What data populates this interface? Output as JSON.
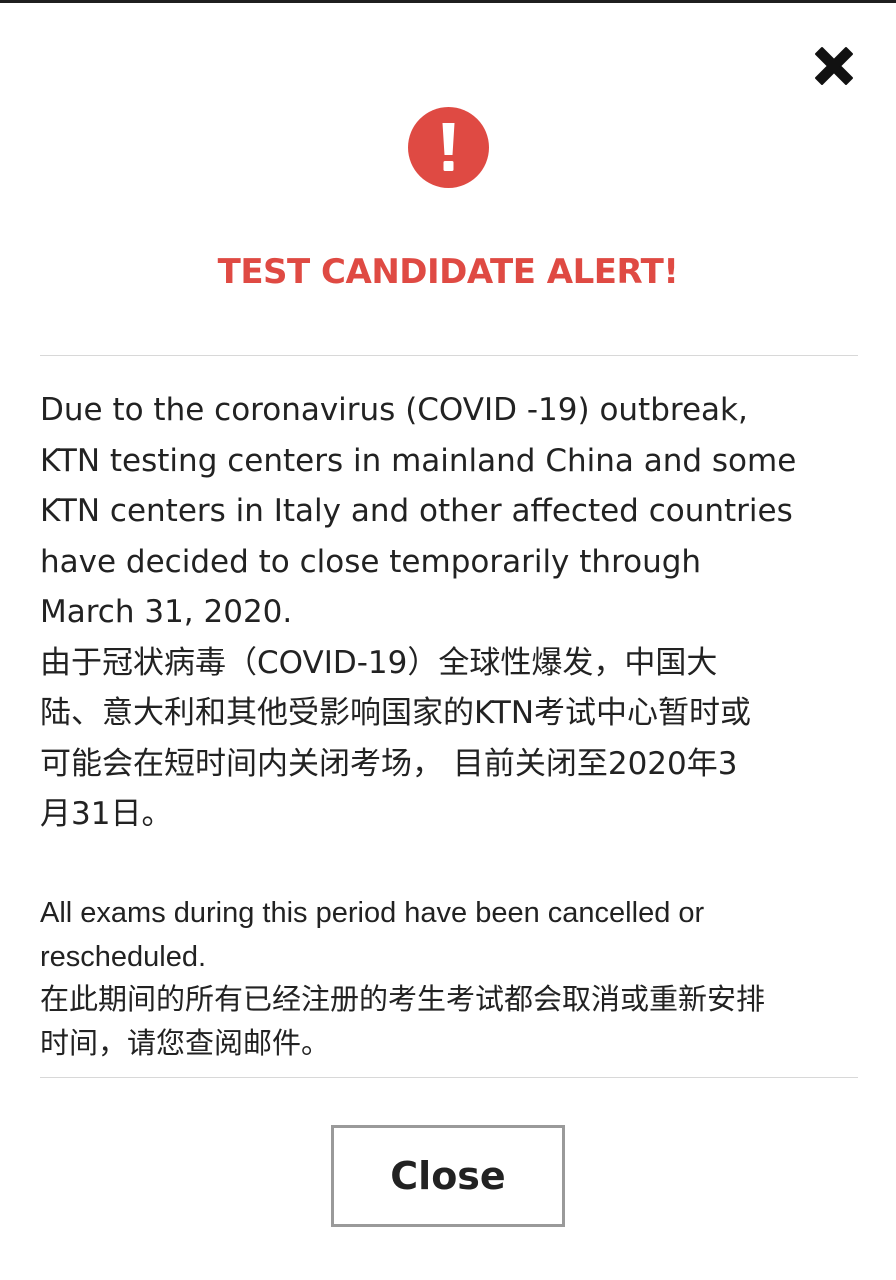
{
  "modal": {
    "title": "TEST CANDIDATE ALERT!",
    "message_en": [
      "Due to the coronavirus (COVID -19) outbreak,",
      "KTN testing centers in mainland China and some",
      "KTN centers in Italy and other affected countries",
      "have decided to close temporarily through",
      "March 31, 2020."
    ],
    "message_zh": [
      "由于冠状病毒（COVID-19）全球性爆发，中国大",
      "陆、意大利和其他受影响国家的KTN考试中心暂时或",
      "可能会在短时间内关闭考场， 目前关闭至2020年3",
      "月31日。"
    ],
    "notice_en": [
      "All exams during this period have been cancelled or",
      "rescheduled."
    ],
    "notice_zh": [
      "在此期间的所有已经注册的考生考试都会取消或重新安排",
      "时间，请您查阅邮件。"
    ],
    "close_button_label": "Close",
    "icons": {
      "dismiss": "close-x-icon",
      "alert": "exclamation-circle-icon"
    },
    "colors": {
      "alert_red": "#df4a43",
      "text": "#222222",
      "button_border": "#9a9a9a"
    }
  }
}
